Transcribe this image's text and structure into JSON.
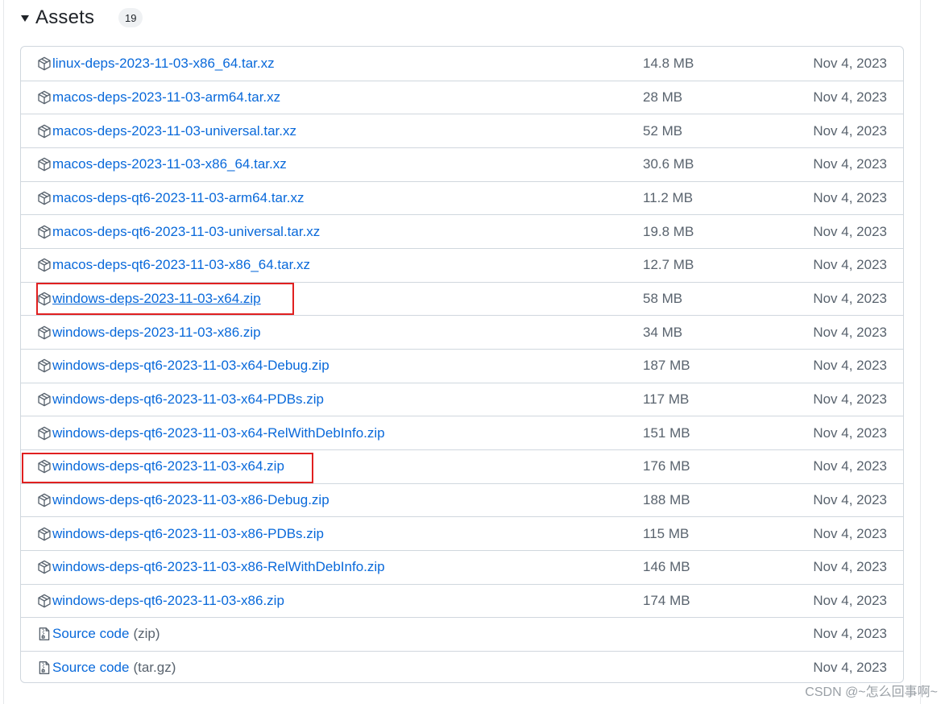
{
  "assets": {
    "title": "Assets",
    "count": "19",
    "items": [
      {
        "name": "linux-deps-2023-11-03-x86_64.tar.xz",
        "size": "14.8 MB",
        "date": "Nov 4, 2023"
      },
      {
        "name": "macos-deps-2023-11-03-arm64.tar.xz",
        "size": "28 MB",
        "date": "Nov 4, 2023"
      },
      {
        "name": "macos-deps-2023-11-03-universal.tar.xz",
        "size": "52 MB",
        "date": "Nov 4, 2023"
      },
      {
        "name": "macos-deps-2023-11-03-x86_64.tar.xz",
        "size": "30.6 MB",
        "date": "Nov 4, 2023"
      },
      {
        "name": "macos-deps-qt6-2023-11-03-arm64.tar.xz",
        "size": "11.2 MB",
        "date": "Nov 4, 2023"
      },
      {
        "name": "macos-deps-qt6-2023-11-03-universal.tar.xz",
        "size": "19.8 MB",
        "date": "Nov 4, 2023"
      },
      {
        "name": "macos-deps-qt6-2023-11-03-x86_64.tar.xz",
        "size": "12.7 MB",
        "date": "Nov 4, 2023"
      },
      {
        "name": "windows-deps-2023-11-03-x64.zip",
        "size": "58 MB",
        "date": "Nov 4, 2023"
      },
      {
        "name": "windows-deps-2023-11-03-x86.zip",
        "size": "34 MB",
        "date": "Nov 4, 2023"
      },
      {
        "name": "windows-deps-qt6-2023-11-03-x64-Debug.zip",
        "size": "187 MB",
        "date": "Nov 4, 2023"
      },
      {
        "name": "windows-deps-qt6-2023-11-03-x64-PDBs.zip",
        "size": "117 MB",
        "date": "Nov 4, 2023"
      },
      {
        "name": "windows-deps-qt6-2023-11-03-x64-RelWithDebInfo.zip",
        "size": "151 MB",
        "date": "Nov 4, 2023"
      },
      {
        "name": "windows-deps-qt6-2023-11-03-x64.zip",
        "size": "176 MB",
        "date": "Nov 4, 2023"
      },
      {
        "name": "windows-deps-qt6-2023-11-03-x86-Debug.zip",
        "size": "188 MB",
        "date": "Nov 4, 2023"
      },
      {
        "name": "windows-deps-qt6-2023-11-03-x86-PDBs.zip",
        "size": "115 MB",
        "date": "Nov 4, 2023"
      },
      {
        "name": "windows-deps-qt6-2023-11-03-x86-RelWithDebInfo.zip",
        "size": "146 MB",
        "date": "Nov 4, 2023"
      },
      {
        "name": "windows-deps-qt6-2023-11-03-x86.zip",
        "size": "174 MB",
        "date": "Nov 4, 2023"
      }
    ],
    "source_items": [
      {
        "label": "Source code",
        "suffix": "(zip)",
        "date": "Nov 4, 2023"
      },
      {
        "label": "Source code",
        "suffix": "(tar.gz)",
        "date": "Nov 4, 2023"
      }
    ],
    "icons": {
      "asset": "package-icon",
      "source": "file-zip-icon",
      "toggle": "triangle-down-icon"
    }
  },
  "watermark": "CSDN @~怎么回事啊~",
  "colors": {
    "link": "#0969da",
    "muted": "#59636e",
    "border": "#d0d7de",
    "highlight": "#e02020"
  }
}
